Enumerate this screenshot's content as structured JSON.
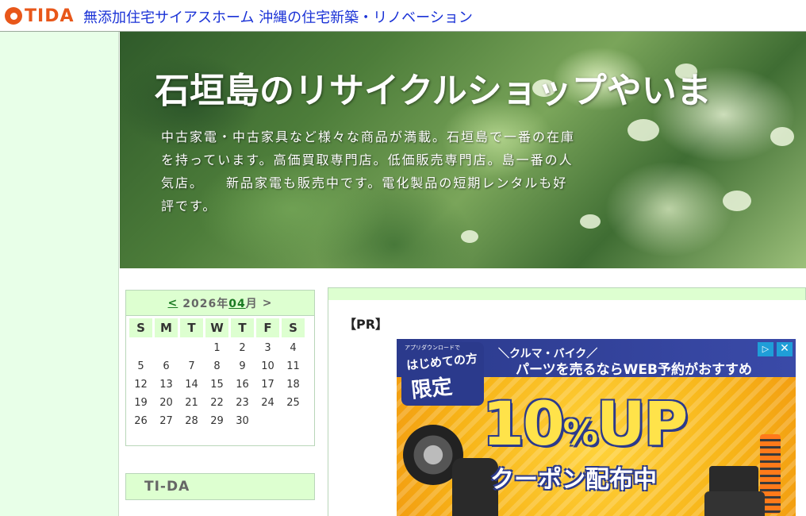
{
  "topbar": {
    "logo_text": "TIDA",
    "site_link": "無添加住宅サイアスホーム 沖縄の住宅新築・リノベーション"
  },
  "banner": {
    "title": "石垣島のリサイクルショップやいま",
    "description": "中古家電・中古家具など様々な商品が満載。石垣島で一番の在庫を持っています。高価買取専門店。低価販売専門店。島一番の人気店。　　新品家電も販売中です。電化製品の短期レンタルも好評です。"
  },
  "calendar": {
    "prev_label": "<",
    "year": "2026",
    "year_suffix": "年",
    "month": "04",
    "month_suffix": "月",
    "next_label": ">",
    "weekdays": [
      "S",
      "M",
      "T",
      "W",
      "T",
      "F",
      "S"
    ],
    "weeks": [
      [
        "",
        "",
        "",
        "1",
        "2",
        "3",
        "4"
      ],
      [
        "5",
        "6",
        "7",
        "8",
        "9",
        "10",
        "11"
      ],
      [
        "12",
        "13",
        "14",
        "15",
        "16",
        "17",
        "18"
      ],
      [
        "19",
        "20",
        "21",
        "22",
        "23",
        "24",
        "25"
      ],
      [
        "26",
        "27",
        "28",
        "29",
        "30",
        "",
        ""
      ]
    ]
  },
  "sidebar": {
    "tida_title": "TI-DA"
  },
  "main": {
    "pr_label": "【PR】"
  },
  "ad": {
    "small_note": "アプリダウンロードで",
    "badge_line1": "はじめての方",
    "badge_line2": "限定",
    "line1": "＼クルマ・バイク／",
    "line2": "パーツを売るならWEB予約がおすすめ",
    "big_number": "10",
    "big_percent": "%",
    "big_up": "UP",
    "coupon": "クーポン配布中",
    "info_icon": "info-icon",
    "close_icon": "close-icon"
  },
  "colors": {
    "brand": "#e8571a",
    "link": "#1a32d6",
    "sidebar_bg": "#e8ffe8",
    "box_header": "#ddffd0",
    "calendar_link": "#1a7a22"
  }
}
